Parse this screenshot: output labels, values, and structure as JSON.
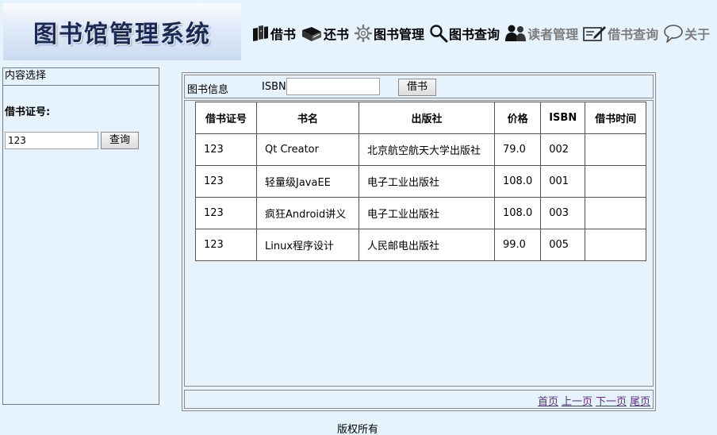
{
  "header": {
    "logo_text": "图书馆管理系统",
    "nav": [
      {
        "label": "借书",
        "icon": "books-icon",
        "style": "dark"
      },
      {
        "label": "还书",
        "icon": "book-return-icon",
        "style": "dark"
      },
      {
        "label": "图书管理",
        "icon": "gear-icon",
        "style": "dark"
      },
      {
        "label": "图书查询",
        "icon": "search-icon",
        "style": "dark"
      },
      {
        "label": "读者管理",
        "icon": "users-icon",
        "style": "gray"
      },
      {
        "label": "借书查询",
        "icon": "edit-note-icon",
        "style": "gray"
      },
      {
        "label": "关于",
        "icon": "speech-bubble-icon",
        "style": "gray"
      }
    ]
  },
  "sidebar": {
    "title": "内容选择",
    "card_label": "借书证号:",
    "card_value": "123",
    "query_button": "查询"
  },
  "main": {
    "toolbar_label": "图书信息",
    "isbn_label": "ISBN",
    "isbn_value": "",
    "borrow_button": "借书",
    "table": {
      "columns": [
        "借书证号",
        "书名",
        "出版社",
        "价格",
        "ISBN",
        "借书时间"
      ],
      "rows": [
        [
          "123",
          "Qt Creator",
          "北京航空航天大学出版社",
          "79.0",
          "002",
          ""
        ],
        [
          "123",
          "轻量级JavaEE",
          "电子工业出版社",
          "108.0",
          "001",
          ""
        ],
        [
          "123",
          "疯狂Android讲义",
          "电子工业出版社",
          "108.0",
          "003",
          ""
        ],
        [
          "123",
          "Linux程序设计",
          "人民邮电出版社",
          "99.0",
          "005",
          ""
        ]
      ]
    },
    "pager": {
      "first": "首页",
      "prev": "上一页",
      "next": "下一页",
      "last": "尾页"
    }
  },
  "footer": {
    "copyright": "版权所有"
  },
  "colors": {
    "background": "#e6f3fd",
    "link": "#5a2b83",
    "nav_gray": "#7d7d7d"
  }
}
